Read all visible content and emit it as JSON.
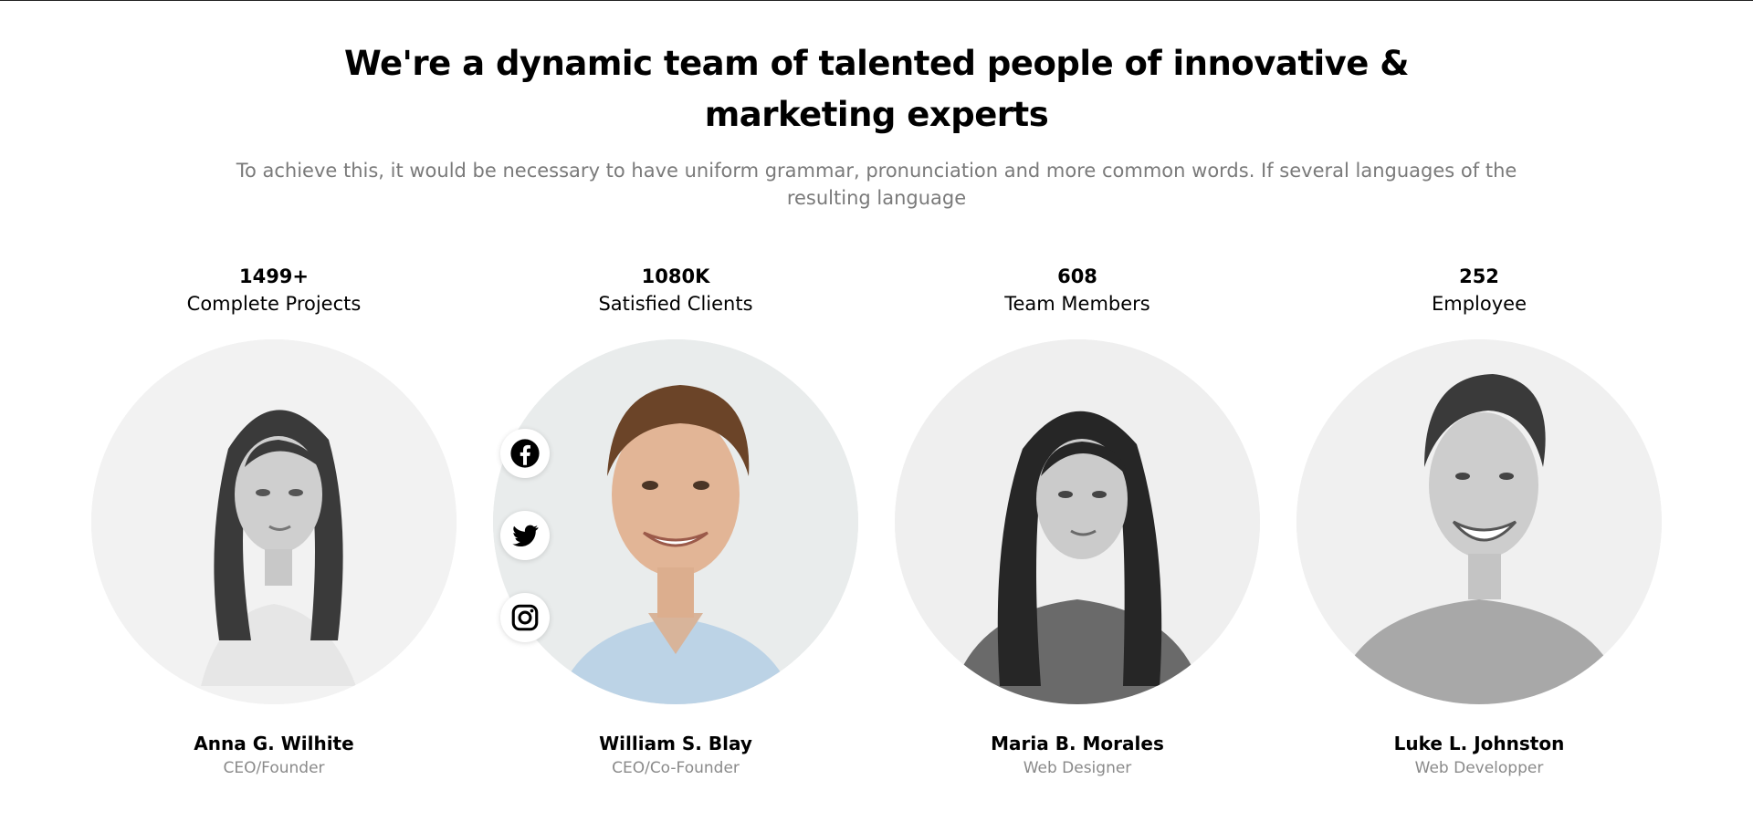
{
  "section": {
    "heading": "We're a dynamic team of talented people of innovative & marketing experts",
    "subtitle": "To achieve this, it would be necessary to have uniform grammar, pronunciation and more common words. If several languages of the resulting language"
  },
  "members": [
    {
      "stat_value": "1499+",
      "stat_label": "Complete Projects",
      "name": "Anna G. Wilhite",
      "role": "CEO/Founder"
    },
    {
      "stat_value": "1080K",
      "stat_label": "Satisfied Clients",
      "name": "William S. Blay",
      "role": "CEO/Co-Founder"
    },
    {
      "stat_value": "608",
      "stat_label": "Team Members",
      "name": "Maria B. Morales",
      "role": "Web Designer"
    },
    {
      "stat_value": "252",
      "stat_label": "Employee",
      "name": "Luke L. Johnston",
      "role": "Web Developper"
    }
  ],
  "social_icons": [
    "facebook-icon",
    "twitter-icon",
    "instagram-icon"
  ],
  "colors": {
    "text": "#000000",
    "muted": "#7a7a7a",
    "background": "#ffffff"
  }
}
